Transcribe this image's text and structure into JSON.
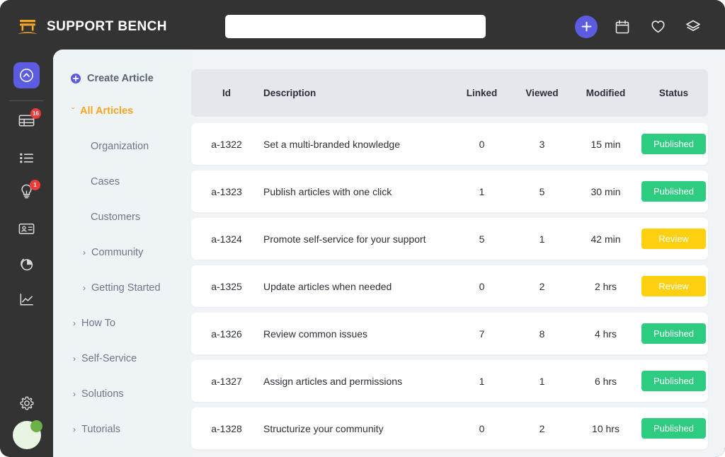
{
  "app": {
    "brand_name": "SUPPORT BENCH",
    "brand_icon": "bench-logo-icon",
    "accent_purple": "#5C5CE0",
    "accent_orange": "#F5A623",
    "frame_dark": "#333333",
    "content_bg": "#F0F4F7"
  },
  "search": {
    "value": "",
    "placeholder": ""
  },
  "topbar": {
    "add_icon": "plus-icon",
    "actions": [
      {
        "icon": "calendar-icon",
        "label": "Calendar"
      },
      {
        "icon": "heart-icon",
        "label": "Favorites"
      },
      {
        "icon": "layers-icon",
        "label": "Layers"
      }
    ]
  },
  "rail": {
    "active_icon": "chevron-up-circle-icon",
    "items": [
      {
        "icon": "table-icon",
        "badge": "16"
      },
      {
        "icon": "list-icon",
        "badge": ""
      },
      {
        "icon": "lightbulb-icon",
        "badge": "1"
      },
      {
        "icon": "id-card-icon",
        "badge": ""
      },
      {
        "icon": "pie-chart-icon",
        "badge": ""
      },
      {
        "icon": "line-chart-icon",
        "badge": ""
      }
    ],
    "settings_icon": "gear-icon",
    "avatar_icon": "user-avatar",
    "avatar_status": "online"
  },
  "nav": {
    "create_label": "Create Article",
    "create_icon": "plus-circle-icon",
    "all_articles": {
      "label": "All Articles",
      "chevron": "ˇ"
    },
    "children": [
      {
        "label": "Organization"
      },
      {
        "label": "Cases"
      },
      {
        "label": "Customers"
      },
      {
        "label": "Community",
        "chevron": "›"
      },
      {
        "label": "Getting Started",
        "chevron": "›"
      }
    ],
    "groups": [
      {
        "label": "How To",
        "chevron": "›"
      },
      {
        "label": "Self-Service",
        "chevron": "›"
      },
      {
        "label": "Solutions",
        "chevron": "›"
      },
      {
        "label": "Tutorials",
        "chevron": "›"
      }
    ]
  },
  "table": {
    "columns": [
      "Id",
      "Description",
      "Linked",
      "Viewed",
      "Modified",
      "Status"
    ],
    "rows": [
      {
        "id": "a-1322",
        "description": "Set a multi-branded knowledge",
        "linked": "0",
        "viewed": "3",
        "modified": "15 min",
        "status": "Published",
        "status_kind": "published"
      },
      {
        "id": "a-1323",
        "description": "Publish articles with one click",
        "linked": "1",
        "viewed": "5",
        "modified": "30 min",
        "status": "Published",
        "status_kind": "published"
      },
      {
        "id": "a-1324",
        "description": "Promote self-service for your support",
        "linked": "5",
        "viewed": "1",
        "modified": "42 min",
        "status": "Review",
        "status_kind": "review"
      },
      {
        "id": "a-1325",
        "description": "Update articles when needed",
        "linked": "0",
        "viewed": "2",
        "modified": "2 hrs",
        "status": "Review",
        "status_kind": "review"
      },
      {
        "id": "a-1326",
        "description": "Review common issues",
        "linked": "7",
        "viewed": "8",
        "modified": "4 hrs",
        "status": "Published",
        "status_kind": "published"
      },
      {
        "id": "a-1327",
        "description": "Assign articles and permissions",
        "linked": "1",
        "viewed": "1",
        "modified": "6 hrs",
        "status": "Published",
        "status_kind": "published"
      },
      {
        "id": "a-1328",
        "description": "Structurize your community",
        "linked": "0",
        "viewed": "2",
        "modified": "10 hrs",
        "status": "Published",
        "status_kind": "published"
      }
    ],
    "status_colors": {
      "published": "#2ECC80",
      "review": "#FFD010"
    }
  }
}
